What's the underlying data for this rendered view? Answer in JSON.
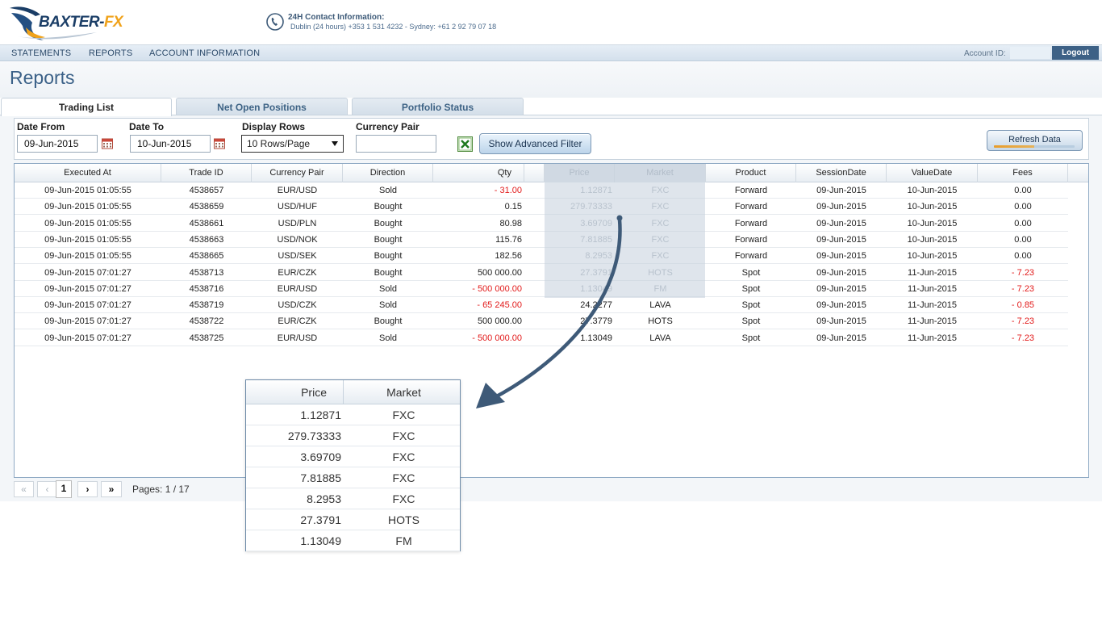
{
  "brand": {
    "logo_main": "BAXTER-",
    "logo_accent": "FX"
  },
  "contact": {
    "title": "24H Contact Information:",
    "line": "Dublin (24 hours) +353 1 531 4232 - Sydney: +61 2 92 79 07 18"
  },
  "nav": {
    "items": [
      "STATEMENTS",
      "REPORTS",
      "ACCOUNT INFORMATION"
    ],
    "account_label": "Account ID:",
    "logout_label": "Logout"
  },
  "page_title": "Reports",
  "tabs": [
    {
      "label": "Trading List",
      "active": true
    },
    {
      "label": "Net Open Positions",
      "active": false
    },
    {
      "label": "Portfolio Status",
      "active": false
    }
  ],
  "filters": {
    "date_from_label": "Date From",
    "date_from_value": "09-Jun-2015",
    "date_to_label": "Date To",
    "date_to_value": "10-Jun-2015",
    "display_rows_label": "Display Rows",
    "display_rows_value": "10 Rows/Page",
    "currency_pair_label": "Currency Pair",
    "currency_pair_value": "",
    "advanced_filter_label": "Show Advanced Filter",
    "refresh_label": "Refresh Data"
  },
  "table": {
    "columns": [
      "Executed At",
      "Trade ID",
      "Currency Pair",
      "Direction",
      "Qty",
      "Price",
      "Market",
      "Product",
      "SessionDate",
      "ValueDate",
      "Fees"
    ],
    "rows": [
      [
        "09-Jun-2015 01:05:55",
        "4538657",
        "EUR/USD",
        "Sold",
        "- 31.00",
        "1.12871",
        "FXC",
        "Forward",
        "09-Jun-2015",
        "10-Jun-2015",
        "0.00"
      ],
      [
        "09-Jun-2015 01:05:55",
        "4538659",
        "USD/HUF",
        "Bought",
        "0.15",
        "279.73333",
        "FXC",
        "Forward",
        "09-Jun-2015",
        "10-Jun-2015",
        "0.00"
      ],
      [
        "09-Jun-2015 01:05:55",
        "4538661",
        "USD/PLN",
        "Bought",
        "80.98",
        "3.69709",
        "FXC",
        "Forward",
        "09-Jun-2015",
        "10-Jun-2015",
        "0.00"
      ],
      [
        "09-Jun-2015 01:05:55",
        "4538663",
        "USD/NOK",
        "Bought",
        "115.76",
        "7.81885",
        "FXC",
        "Forward",
        "09-Jun-2015",
        "10-Jun-2015",
        "0.00"
      ],
      [
        "09-Jun-2015 01:05:55",
        "4538665",
        "USD/SEK",
        "Bought",
        "182.56",
        "8.2953",
        "FXC",
        "Forward",
        "09-Jun-2015",
        "10-Jun-2015",
        "0.00"
      ],
      [
        "09-Jun-2015 07:01:27",
        "4538713",
        "EUR/CZK",
        "Bought",
        "500 000.00",
        "27.3791",
        "HOTS",
        "Spot",
        "09-Jun-2015",
        "11-Jun-2015",
        "- 7.23"
      ],
      [
        "09-Jun-2015 07:01:27",
        "4538716",
        "EUR/USD",
        "Sold",
        "- 500 000.00",
        "1.13049",
        "FM",
        "Spot",
        "09-Jun-2015",
        "11-Jun-2015",
        "- 7.23"
      ],
      [
        "09-Jun-2015 07:01:27",
        "4538719",
        "USD/CZK",
        "Sold",
        "- 65 245.00",
        "24.2277",
        "LAVA",
        "Spot",
        "09-Jun-2015",
        "11-Jun-2015",
        "- 0.85"
      ],
      [
        "09-Jun-2015 07:01:27",
        "4538722",
        "EUR/CZK",
        "Bought",
        "500 000.00",
        "27.3779",
        "HOTS",
        "Spot",
        "09-Jun-2015",
        "11-Jun-2015",
        "- 7.23"
      ],
      [
        "09-Jun-2015 07:01:27",
        "4538725",
        "EUR/USD",
        "Sold",
        "- 500 000.00",
        "1.13049",
        "LAVA",
        "Spot",
        "09-Jun-2015",
        "11-Jun-2015",
        "- 7.23"
      ]
    ]
  },
  "pager": {
    "first": "«",
    "prev": "‹",
    "current": "1",
    "next": "›",
    "last": "»",
    "pages_label": "Pages: 1 / 17"
  },
  "zoom_callout": {
    "columns": [
      "Price",
      "Market"
    ],
    "rows": [
      [
        "1.12871",
        "FXC"
      ],
      [
        "279.73333",
        "FXC"
      ],
      [
        "3.69709",
        "FXC"
      ],
      [
        "7.81885",
        "FXC"
      ],
      [
        "8.2953",
        "FXC"
      ],
      [
        "27.3791",
        "HOTS"
      ],
      [
        "1.13049",
        "FM"
      ]
    ]
  },
  "colors": {
    "brand_blue": "#1a3d66",
    "brand_orange": "#f0a21a",
    "negative": "#e21b1b",
    "nav_dark": "#3d6186",
    "arrow": "#3e5a78"
  }
}
